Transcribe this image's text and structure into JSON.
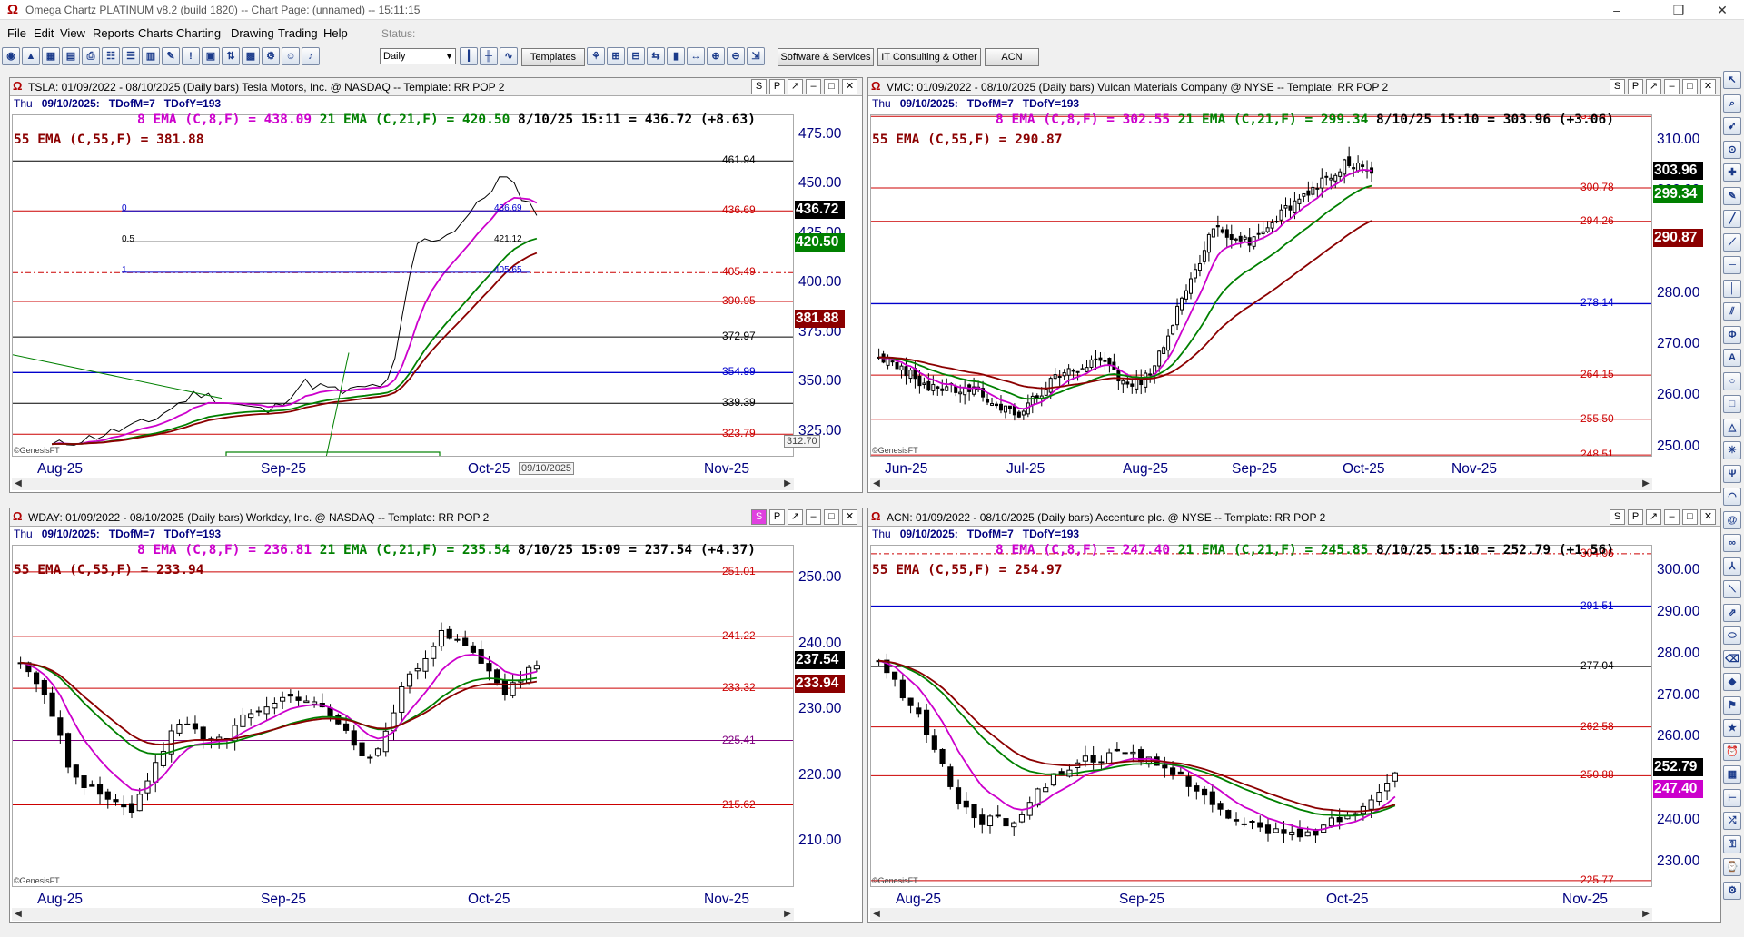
{
  "window": {
    "title": "Omega Chartz PLATINUM v8.2 (build 1820)  --  Chart Page: (unnamed)  --  15:11:15",
    "status_label": "Status:"
  },
  "menu": [
    "File",
    "Edit",
    "View",
    "Reports",
    "Charts",
    "Charting",
    "Drawing",
    "Trading",
    "Help"
  ],
  "toolbar": {
    "period": "Daily",
    "templates_label": "Templates",
    "wide_buttons": [
      "Software & Services",
      "IT Consulting & Other",
      "ACN"
    ]
  },
  "colors": {
    "ema8": "#cc00cc",
    "ema21": "#008000",
    "ema55": "#8b0000",
    "axis": "#000080",
    "price_line": "#000000"
  },
  "panels": [
    {
      "id": "tsla",
      "title": "TSLA: 01/09/2022 - 08/10/2025  (Daily bars)   Tesla Motors, Inc. @ NASDAQ  --  Template: RR POP 2",
      "day": "Thu",
      "date": "09/10/2025:",
      "tdofm": "TDofM=7",
      "tdofy": "TDofY=193",
      "ema8": "8 EMA (C,8,F) = 438.09",
      "ema21": "21 EMA (C,21,F) = 420.50",
      "last": "8/10/25 15:11 = 436.72 (+8.63)",
      "ema55": "55 EMA (C,55,F) = 381.88",
      "yticks": [
        "475.00",
        "450.00",
        "425.00",
        "400.00",
        "375.00",
        "350.00",
        "325.00"
      ],
      "tags": [
        {
          "text": "436.72",
          "bg": "#000000",
          "fg": "#ffffff"
        },
        {
          "text": "420.50",
          "bg": "#008000",
          "fg": "#ffffff"
        },
        {
          "text": "381.88",
          "bg": "#8b0000",
          "fg": "#ffffff"
        }
      ],
      "xticks": [
        "Aug-25",
        "Sep-25",
        "Oct-25",
        "Nov-25"
      ],
      "levels": [
        "461.94",
        "436.69",
        "405.49",
        "390.95",
        "372.97",
        "354.99",
        "339.39",
        "323.79"
      ],
      "fib": {
        "l0": "0",
        "l05": "0.5",
        "l1": "1",
        "v0": "436.69",
        "v05": "421.12",
        "v1": "405.65"
      },
      "corner_price": "312.70",
      "date_box": "09/10/2025",
      "watermark": "©GenesisFT"
    },
    {
      "id": "vmc",
      "title": "VMC: 01/09/2022 - 08/10/2025  (Daily bars)   Vulcan Materials Company @ NYSE  --  Template: RR POP 2",
      "day": "Thu",
      "date": "09/10/2025:",
      "tdofm": "TDofM=7",
      "tdofy": "TDofY=193",
      "ema8": "8 EMA (C,8,F) = 302.55",
      "ema21": "21 EMA (C,21,F) = 299.34",
      "last": "8/10/25 15:10 = 303.96 (+3.06)",
      "ema55": "55 EMA (C,55,F) = 290.87",
      "yticks": [
        "310.00",
        "300.00",
        "290.00",
        "280.00",
        "270.00",
        "260.00",
        "250.00"
      ],
      "tags": [
        {
          "text": "303.96",
          "bg": "#000000",
          "fg": "#ffffff"
        },
        {
          "text": "299.34",
          "bg": "#008000",
          "fg": "#ffffff"
        },
        {
          "text": "290.87",
          "bg": "#8b0000",
          "fg": "#ffffff"
        }
      ],
      "xticks": [
        "Jun-25",
        "Jul-25",
        "Aug-25",
        "Sep-25",
        "Oct-25",
        "Nov-25"
      ],
      "levels": [
        "314.77",
        "300.78",
        "294.26",
        "278.14",
        "264.15",
        "255.50",
        "248.51"
      ],
      "watermark": "©GenesisFT"
    },
    {
      "id": "wday",
      "title": "WDAY: 01/09/2022 - 08/10/2025  (Daily bars)   Workday, Inc. @ NASDAQ  --  Template: RR POP 2",
      "day": "Thu",
      "date": "09/10/2025:",
      "tdofm": "TDofM=7",
      "tdofy": "TDofY=193",
      "ema8": "8 EMA (C,8,F) = 236.81",
      "ema21": "21 EMA (C,21,F) = 235.54",
      "last": "8/10/25 15:09 = 237.54 (+4.37)",
      "ema55": "55 EMA (C,55,F) = 233.94",
      "yticks": [
        "250.00",
        "240.00",
        "230.00",
        "220.00",
        "210.00"
      ],
      "tags": [
        {
          "text": "237.54",
          "bg": "#000000",
          "fg": "#ffffff"
        },
        {
          "text": "233.94",
          "bg": "#8b0000",
          "fg": "#ffffff"
        }
      ],
      "xticks": [
        "Aug-25",
        "Sep-25",
        "Oct-25",
        "Nov-25"
      ],
      "levels": [
        "251.01",
        "241.22",
        "233.32",
        "225.41",
        "215.62"
      ],
      "watermark": "©GenesisFT"
    },
    {
      "id": "acn",
      "title": "ACN: 01/09/2022 - 08/10/2025  (Daily bars)   Accenture plc. @ NYSE  --  Template: RR POP 2",
      "day": "Thu",
      "date": "09/10/2025:",
      "tdofm": "TDofM=7",
      "tdofy": "TDofY=193",
      "ema8": "8 EMA (C,8,F) = 247.40",
      "ema21": "21 EMA (C,21,F) = 245.85",
      "last": "8/10/25 15:10 = 252.79 (+1.56)",
      "ema55": "55 EMA (C,55,F) = 254.97",
      "yticks": [
        "300.00",
        "290.00",
        "280.00",
        "270.00",
        "260.00",
        "240.00",
        "230.00"
      ],
      "tags": [
        {
          "text": "252.79",
          "bg": "#000000",
          "fg": "#ffffff"
        },
        {
          "text": "247.40",
          "bg": "#cc00cc",
          "fg": "#ffffff"
        }
      ],
      "xticks": [
        "Aug-25",
        "Sep-25",
        "Oct-25",
        "Nov-25"
      ],
      "levels": [
        "304.06",
        "291.51",
        "277.04",
        "262.58",
        "250.88",
        "225.77"
      ],
      "watermark": "©GenesisFT"
    }
  ]
}
